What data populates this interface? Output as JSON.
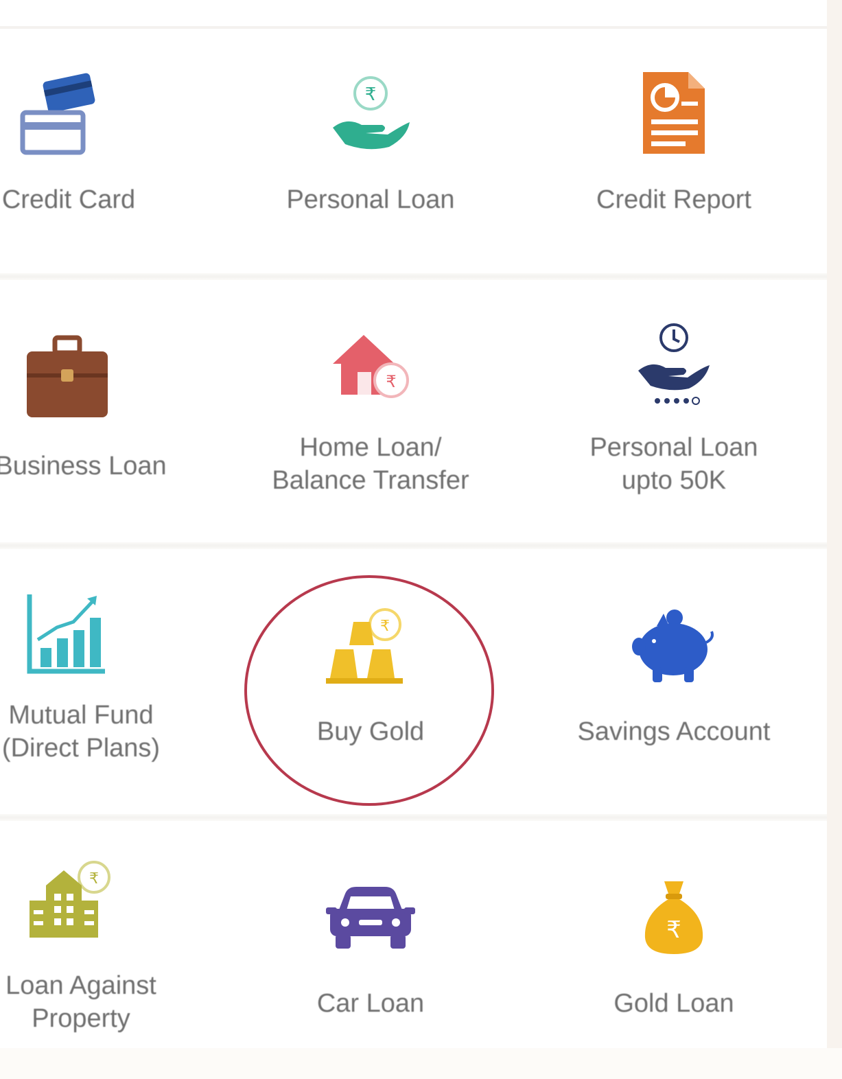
{
  "products": [
    {
      "id": "credit-card",
      "label": "Credit Card",
      "icon": "credit-card-icon"
    },
    {
      "id": "personal-loan",
      "label": "Personal Loan",
      "icon": "hand-rupee-coin-icon"
    },
    {
      "id": "credit-report",
      "label": "Credit Report",
      "icon": "report-document-icon"
    },
    {
      "id": "business-loan",
      "label": "Business Loan",
      "icon": "briefcase-icon"
    },
    {
      "id": "home-loan",
      "label": "Home Loan/\nBalance Transfer",
      "icon": "house-rupee-icon"
    },
    {
      "id": "personal-loan-50k",
      "label": "Personal Loan\nupto 50K",
      "icon": "hand-coin-dots-icon"
    },
    {
      "id": "mutual-fund",
      "label": "Mutual Fund\n(Direct Plans)",
      "icon": "growth-chart-icon"
    },
    {
      "id": "buy-gold",
      "label": "Buy Gold",
      "icon": "gold-bars-icon"
    },
    {
      "id": "savings-account",
      "label": "Savings Account",
      "icon": "piggy-bank-icon"
    },
    {
      "id": "loan-against-property",
      "label": "Loan Against\nProperty",
      "icon": "building-rupee-icon"
    },
    {
      "id": "car-loan",
      "label": "Car Loan",
      "icon": "car-icon"
    },
    {
      "id": "gold-loan",
      "label": "Gold Loan",
      "icon": "money-bag-icon"
    }
  ],
  "highlighted": "buy-gold",
  "colors": {
    "label": "#6f6f6f",
    "highlight_ring": "#b7394d",
    "credit_card": "#7a8fc4",
    "personal_loan": "#2fae8f",
    "credit_report": "#e57a2d",
    "business_loan": "#8a4a2f",
    "home_loan": "#e4606a",
    "personal_loan_50k": "#2b3a6b",
    "mutual_fund": "#3fb8c4",
    "buy_gold": "#f0c02a",
    "savings_account": "#2d5cc8",
    "loan_against_property": "#b3b23c",
    "car_loan": "#5b4aa0",
    "gold_loan": "#f2b41c"
  }
}
